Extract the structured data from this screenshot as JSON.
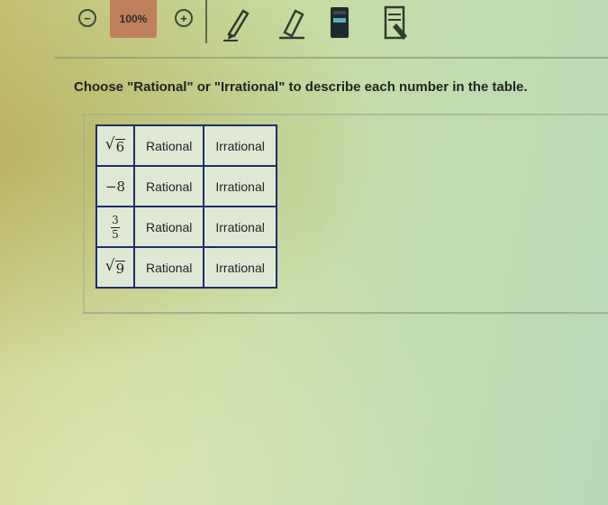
{
  "toolbar": {
    "zoom_out_symbol": "−",
    "zoom_level": "100%",
    "zoom_in_symbol": "+",
    "tools": [
      "pencil-icon",
      "eraser-icon",
      "highlighter-icon",
      "answer-eliminator-icon"
    ]
  },
  "question": {
    "prompt": "Choose \"Rational\" or \"Irrational\" to describe each number in the table."
  },
  "table": {
    "rows": [
      {
        "number_type": "sqrt",
        "radicand": "6",
        "option_a": "Rational",
        "option_b": "Irrational"
      },
      {
        "number_type": "text",
        "number": "−8",
        "option_a": "Rational",
        "option_b": "Irrational"
      },
      {
        "number_type": "fraction",
        "numerator": "3",
        "denominator": "5",
        "option_a": "Rational",
        "option_b": "Irrational"
      },
      {
        "number_type": "sqrt",
        "radicand": "9",
        "option_a": "Rational",
        "option_b": "Irrational"
      }
    ]
  },
  "colors": {
    "zoom_level_bg": "#c0805e",
    "table_border": "#1d2f6b"
  }
}
